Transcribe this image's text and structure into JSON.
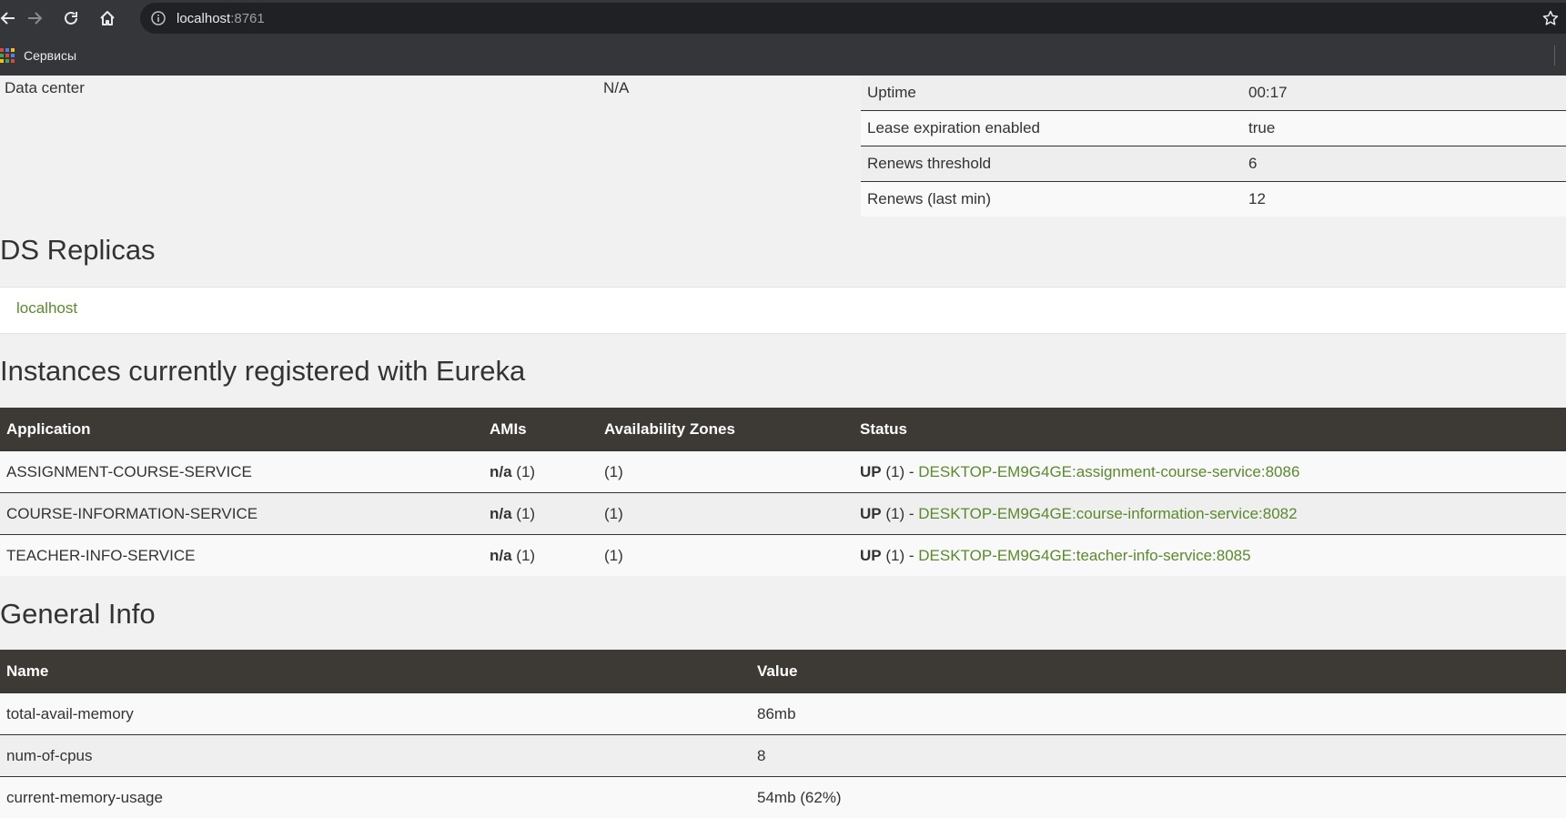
{
  "browser": {
    "url_host": "localhost",
    "url_port": ":8761",
    "bookmark_label": "Сервисы"
  },
  "system_status": {
    "data_center_label": "Data center",
    "data_center_value": "N/A",
    "rows": [
      {
        "key": "Uptime",
        "value": "00:17"
      },
      {
        "key": "Lease expiration enabled",
        "value": "true"
      },
      {
        "key": "Renews threshold",
        "value": "6"
      },
      {
        "key": "Renews (last min)",
        "value": "12"
      }
    ]
  },
  "ds_replicas": {
    "title": "DS Replicas",
    "items": [
      "localhost"
    ]
  },
  "instances": {
    "title": "Instances currently registered with Eureka",
    "headers": [
      "Application",
      "AMIs",
      "Availability Zones",
      "Status"
    ],
    "rows": [
      {
        "application": "ASSIGNMENT-COURSE-SERVICE",
        "ami_bold": "n/a",
        "ami_count": " (1)",
        "zones": "(1)",
        "status_bold": "UP",
        "status_count": " (1) - ",
        "instance": "DESKTOP-EM9G4GE:assignment-course-service:8086"
      },
      {
        "application": "COURSE-INFORMATION-SERVICE",
        "ami_bold": "n/a",
        "ami_count": " (1)",
        "zones": "(1)",
        "status_bold": "UP",
        "status_count": " (1) - ",
        "instance": "DESKTOP-EM9G4GE:course-information-service:8082"
      },
      {
        "application": "TEACHER-INFO-SERVICE",
        "ami_bold": "n/a",
        "ami_count": " (1)",
        "zones": "(1)",
        "status_bold": "UP",
        "status_count": " (1) - ",
        "instance": "DESKTOP-EM9G4GE:teacher-info-service:8085"
      }
    ]
  },
  "general_info": {
    "title": "General Info",
    "headers": [
      "Name",
      "Value"
    ],
    "rows": [
      {
        "name": "total-avail-memory",
        "value": "86mb"
      },
      {
        "name": "num-of-cpus",
        "value": "8"
      },
      {
        "name": "current-memory-usage",
        "value": "54mb (62%)"
      }
    ]
  },
  "colors": {
    "header_bg": "#3d3935",
    "link_green": "#5a8a2c",
    "chrome_bg": "#35363a"
  },
  "icons": [
    "back-icon",
    "forward-icon",
    "reload-icon",
    "home-icon",
    "info-icon",
    "star-icon",
    "apps-icon"
  ]
}
